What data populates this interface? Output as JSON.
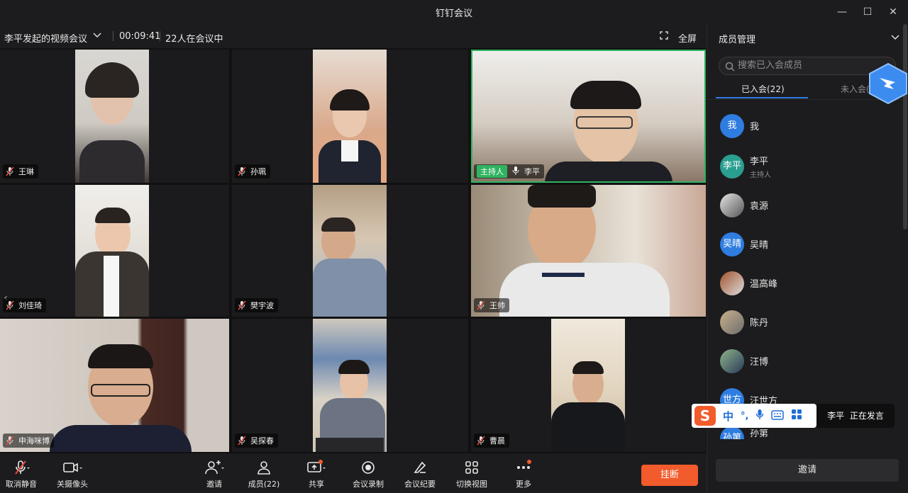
{
  "window": {
    "title": "钉钉会议"
  },
  "meeting": {
    "name": "李平发起的视频会议",
    "timer": "00:09:41",
    "count": "22人在会议中",
    "fullscreen_label": "全屏"
  },
  "tiles": [
    {
      "name": "王琳",
      "muted": true
    },
    {
      "name": "孙珮",
      "muted": true
    },
    {
      "name": "李平",
      "host_label": "主持人",
      "speaking": true
    },
    {
      "name": "刘佳琦",
      "muted": true
    },
    {
      "name": "樊宇波",
      "muted": true
    },
    {
      "name": "王帅",
      "muted": true
    },
    {
      "name": "申海咪博",
      "muted": true
    },
    {
      "name": "吴探春",
      "muted": true
    },
    {
      "name": "曹晨",
      "muted": true
    }
  ],
  "toolbar": {
    "mute": "取消静音",
    "camera": "关摄像头",
    "invite": "邀请",
    "members": "成员(22)",
    "share": "共享",
    "record": "会议录制",
    "minutes": "会议纪要",
    "view": "切换视图",
    "more": "更多",
    "hangup": "挂断"
  },
  "panel": {
    "title": "成员管理",
    "search_placeholder": "搜索已入会成员",
    "tab_joined": "已入会(22)",
    "tab_notjoined": "未入会(",
    "members": [
      {
        "avatar_text": "我",
        "name": "我",
        "role": ""
      },
      {
        "avatar_text": "李平",
        "name": "李平",
        "role": "主持人"
      },
      {
        "avatar_text": "",
        "name": "袁源",
        "role": ""
      },
      {
        "avatar_text": "吴晴",
        "name": "吴晴",
        "role": ""
      },
      {
        "avatar_text": "",
        "name": "温高峰",
        "role": ""
      },
      {
        "avatar_text": "",
        "name": "陈丹",
        "role": ""
      },
      {
        "avatar_text": "",
        "name": "汪博",
        "role": ""
      },
      {
        "avatar_text": "世方",
        "name": "汪世方",
        "role": ""
      },
      {
        "avatar_text": "孙第",
        "name": "孙第",
        "role": ""
      }
    ],
    "invite_label": "邀请"
  },
  "ime": {
    "label": "中",
    "punct": "°,"
  },
  "toast": {
    "speaker": "李平",
    "status": "正在发言"
  },
  "colors": {
    "accent": "#2f7de1",
    "speaking": "#2fb360",
    "hangup": "#f25b2b"
  }
}
